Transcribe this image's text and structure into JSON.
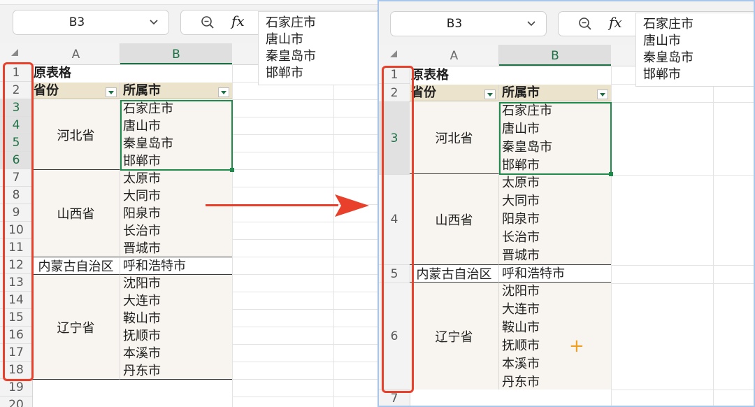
{
  "left": {
    "namebox": "B3",
    "formula_lines": [
      "石家庄市",
      "唐山市",
      "秦皇岛市",
      "邯郸市"
    ],
    "col_headers": [
      "A",
      "B"
    ],
    "row_numbers": [
      "1",
      "2",
      "3",
      "4",
      "5",
      "6",
      "7",
      "8",
      "9",
      "10",
      "11",
      "12",
      "13",
      "14",
      "15",
      "16",
      "17",
      "18",
      "19",
      "20"
    ],
    "title": "原表格",
    "header_a": "省份",
    "header_b": "所属市",
    "groups": [
      {
        "province": "河北省",
        "cities": [
          "石家庄市",
          "唐山市",
          "秦皇岛市",
          "邯郸市"
        ]
      },
      {
        "province": "山西省",
        "cities": [
          "太原市",
          "大同市",
          "阳泉市",
          "长治市",
          "晋城市"
        ]
      },
      {
        "province": "内蒙古自治区",
        "cities": [
          "呼和浩特市"
        ]
      },
      {
        "province": "辽宁省",
        "cities": [
          "沈阳市",
          "大连市",
          "鞍山市",
          "抚顺市",
          "本溪市",
          "丹东市"
        ]
      }
    ]
  },
  "right": {
    "namebox": "B3",
    "formula_lines": [
      "石家庄市",
      "唐山市",
      "秦皇岛市",
      "邯郸市"
    ],
    "col_headers": [
      "A",
      "B"
    ],
    "row_numbers": [
      "1",
      "2",
      "3",
      "4",
      "5",
      "6",
      "7"
    ],
    "title": "原表格",
    "header_a": "省份",
    "header_b": "所属市",
    "groups": [
      {
        "province": "河北省",
        "cities": [
          "石家庄市",
          "唐山市",
          "秦皇岛市",
          "邯郸市"
        ]
      },
      {
        "province": "山西省",
        "cities": [
          "太原市",
          "大同市",
          "阳泉市",
          "长治市",
          "晋城市"
        ]
      },
      {
        "province": "内蒙古自治区",
        "cities": [
          "呼和浩特市"
        ]
      },
      {
        "province": "辽宁省",
        "cities": [
          "沈阳市",
          "大连市",
          "鞍山市",
          "抚顺市",
          "本溪市",
          "丹东市"
        ]
      }
    ],
    "cursor_symbol": "+"
  },
  "colors": {
    "highlight": "#e8402a",
    "selection": "#1e8a4c",
    "header_fill": "#ece3cc",
    "cell_fill": "#f8f4ef",
    "pane_border": "#a7c6ea"
  }
}
